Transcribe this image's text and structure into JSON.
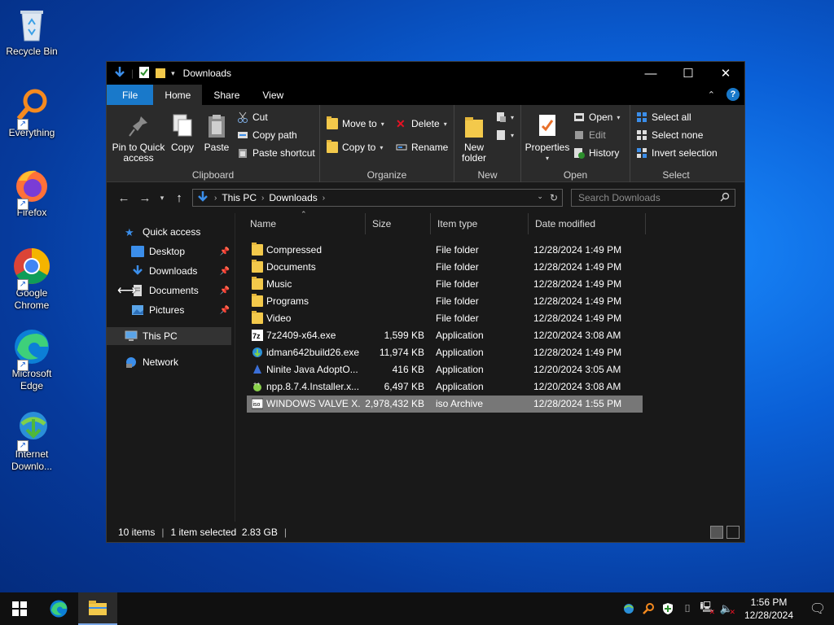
{
  "desktop": {
    "icons": [
      {
        "label": "Recycle Bin"
      },
      {
        "label": "Everything"
      },
      {
        "label": "Firefox"
      },
      {
        "label": "Google Chrome"
      },
      {
        "label": "Microsoft Edge"
      },
      {
        "label": "Internet Downlo..."
      }
    ]
  },
  "window": {
    "title": "Downloads",
    "tabs": [
      "File",
      "Home",
      "Share",
      "View"
    ],
    "active_tab": "Home"
  },
  "ribbon": {
    "clipboard": {
      "pin_label": "Pin to Quick access",
      "copy_label": "Copy",
      "paste_label": "Paste",
      "cut_label": "Cut",
      "copy_path_label": "Copy path",
      "paste_shortcut_label": "Paste shortcut",
      "group_label": "Clipboard"
    },
    "organize": {
      "move_to_label": "Move to",
      "copy_to_label": "Copy to",
      "delete_label": "Delete",
      "rename_label": "Rename",
      "group_label": "Organize"
    },
    "new": {
      "new_folder_label": "New folder",
      "group_label": "New"
    },
    "open": {
      "properties_label": "Properties",
      "open_label": "Open",
      "edit_label": "Edit",
      "history_label": "History",
      "group_label": "Open"
    },
    "select": {
      "select_all_label": "Select all",
      "select_none_label": "Select none",
      "invert_label": "Invert selection",
      "group_label": "Select"
    }
  },
  "address": {
    "crumbs": [
      "This PC",
      "Downloads"
    ],
    "search_placeholder": "Search Downloads"
  },
  "navpane": {
    "quick_access": "Quick access",
    "desktop": "Desktop",
    "downloads": "Downloads",
    "documents": "Documents",
    "pictures": "Pictures",
    "this_pc": "This PC",
    "network": "Network"
  },
  "columns": {
    "name": "Name",
    "size": "Size",
    "type": "Item type",
    "date": "Date modified"
  },
  "files": [
    {
      "name": "Compressed",
      "size": "",
      "type": "File folder",
      "date": "12/28/2024 1:49 PM"
    },
    {
      "name": "Documents",
      "size": "",
      "type": "File folder",
      "date": "12/28/2024 1:49 PM"
    },
    {
      "name": "Music",
      "size": "",
      "type": "File folder",
      "date": "12/28/2024 1:49 PM"
    },
    {
      "name": "Programs",
      "size": "",
      "type": "File folder",
      "date": "12/28/2024 1:49 PM"
    },
    {
      "name": "Video",
      "size": "",
      "type": "File folder",
      "date": "12/28/2024 1:49 PM"
    },
    {
      "name": "7z2409-x64.exe",
      "size": "1,599 KB",
      "type": "Application",
      "date": "12/20/2024 3:08 AM"
    },
    {
      "name": "idman642build26.exe",
      "size": "11,974 KB",
      "type": "Application",
      "date": "12/28/2024 1:49 PM"
    },
    {
      "name": "Ninite Java AdoptO...",
      "size": "416 KB",
      "type": "Application",
      "date": "12/20/2024 3:05 AM"
    },
    {
      "name": "npp.8.7.4.Installer.x...",
      "size": "6,497 KB",
      "type": "Application",
      "date": "12/20/2024 3:08 AM"
    },
    {
      "name": "WINDOWS VALVE X...",
      "size": "2,978,432 KB",
      "type": "iso Archive",
      "date": "12/28/2024 1:55 PM"
    }
  ],
  "status": {
    "items": "10 items",
    "selected": "1 item selected  2.83 GB"
  },
  "taskbar": {
    "time": "1:56 PM",
    "date": "12/28/2024"
  },
  "colors": {
    "accent": "#1979ca",
    "folder": "#f3c94b",
    "selected_row": "#777777"
  }
}
